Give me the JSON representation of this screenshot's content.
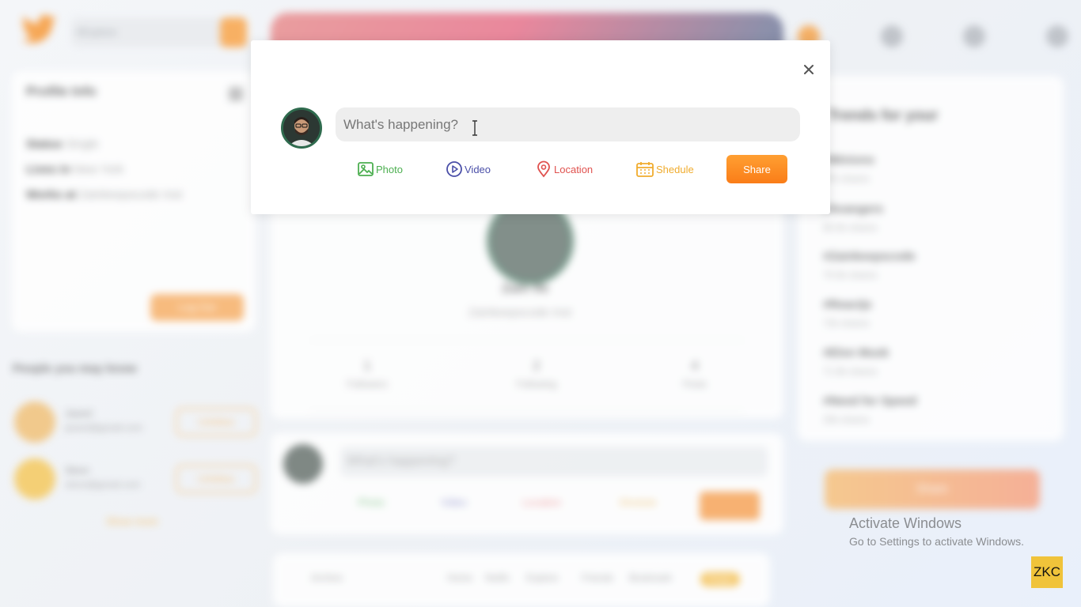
{
  "header": {
    "search_placeholder": "#Explore"
  },
  "profile_info": {
    "title": "Profile Info",
    "status_label": "Status",
    "status_value": "Single",
    "lives_label": "Lives in",
    "lives_value": "New York",
    "works_label": "Works at",
    "works_value": "Zainkeepscode Inst",
    "logout_label": "Log Out"
  },
  "people": {
    "title": "People you may know",
    "items": [
      {
        "name": "Jaseel",
        "email": "jaseel@gmail.com",
        "button": "Unfollow"
      },
      {
        "name": "Steve",
        "email": "steve@gmail.com",
        "button": "Unfollow"
      }
    ],
    "see_more": "Show more"
  },
  "profile": {
    "name": "Zain Ife",
    "work": "Zainkeepscode Inst",
    "stats": [
      {
        "value": "1",
        "label": "Followers"
      },
      {
        "value": "2",
        "label": "Following"
      },
      {
        "value": "4",
        "label": "Posts"
      }
    ]
  },
  "post_box": {
    "placeholder": "What's happening?",
    "options": [
      "Photo",
      "Video",
      "Location",
      "Shedule"
    ],
    "share": "Share"
  },
  "bottom_nav": {
    "items": [
      "Archive",
      "Home",
      "Notifs",
      "Explore",
      "Friends",
      "Bookmark"
    ],
    "badge": "Posts"
  },
  "trends": {
    "title": "Trends for your",
    "items": [
      {
        "tag": "#Minions",
        "shares": "97k shares"
      },
      {
        "tag": "#Avangers",
        "shares": "80.5k shares"
      },
      {
        "tag": "#Zainkeepscode",
        "shares": "75.5k shares"
      },
      {
        "tag": "#Reactjs",
        "shares": "72k shares"
      },
      {
        "tag": "#Elon Musk",
        "shares": "71.9k shares"
      },
      {
        "tag": "#Need for Speed",
        "shares": "20k shares"
      }
    ],
    "share_button": "Share"
  },
  "modal": {
    "placeholder": "What's happening?",
    "options": [
      {
        "label": "Photo",
        "color": "#4caf50"
      },
      {
        "label": "Video",
        "color": "#4a4fa8"
      },
      {
        "label": "Location",
        "color": "#e0524f"
      },
      {
        "label": "Shedule",
        "color": "#f0ac2e"
      }
    ],
    "share_label": "Share"
  },
  "watermark": {
    "line1": "Activate Windows",
    "line2": "Go to Settings to activate Windows.",
    "badge": "ZKC"
  }
}
